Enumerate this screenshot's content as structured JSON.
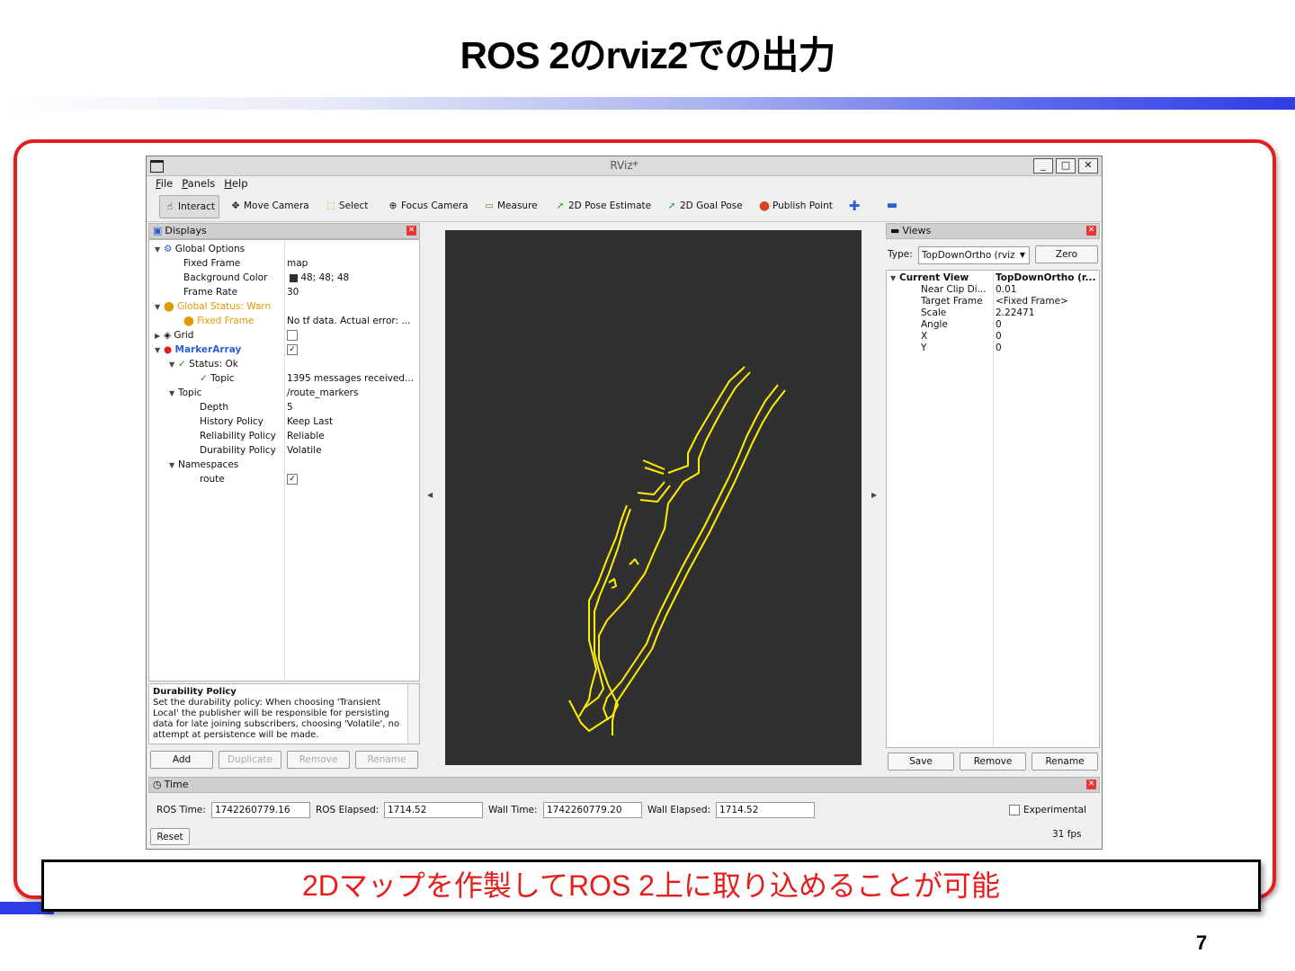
{
  "slide": {
    "title": "ROS 2のrviz2での出力",
    "caption": "2Dマップを作製してROS 2上に取り込めることが可能",
    "page_number": "7"
  },
  "window": {
    "title": "RViz*",
    "controls": {
      "minimize": "_",
      "maximize": "□",
      "close": "✕"
    }
  },
  "menu": [
    "File",
    "Panels",
    "Help"
  ],
  "toolbar": [
    {
      "label": "Interact",
      "icon": "hand-icon",
      "active": true
    },
    {
      "label": "Move Camera",
      "icon": "move-camera-icon"
    },
    {
      "label": "Select",
      "icon": "select-icon"
    },
    {
      "label": "Focus Camera",
      "icon": "focus-camera-icon"
    },
    {
      "label": "Measure",
      "icon": "ruler-icon"
    },
    {
      "label": "2D Pose Estimate",
      "icon": "green-arrow-icon"
    },
    {
      "label": "2D Goal Pose",
      "icon": "green-arrow-icon"
    },
    {
      "label": "Publish Point",
      "icon": "map-pin-icon"
    },
    {
      "label": "",
      "icon": "plus-icon"
    },
    {
      "label": "",
      "icon": "minus-dropdown-icon"
    }
  ],
  "displays": {
    "header": "Displays",
    "rows": [
      {
        "name": "Global Options",
        "value": ""
      },
      {
        "name": "Fixed Frame",
        "value": "map"
      },
      {
        "name": "Background Color",
        "value": "48; 48; 48"
      },
      {
        "name": "Frame Rate",
        "value": "30"
      },
      {
        "name": "Global Status: Warn",
        "value": ""
      },
      {
        "name": "Fixed Frame",
        "value": "No tf data.  Actual error: ..."
      },
      {
        "name": "Grid",
        "value": ""
      },
      {
        "name": "MarkerArray",
        "value": ""
      },
      {
        "name": "Status: Ok",
        "value": ""
      },
      {
        "name": "Topic",
        "value": "1395 messages received..."
      },
      {
        "name": "Topic",
        "value": "/route_markers"
      },
      {
        "name": "Depth",
        "value": "5"
      },
      {
        "name": "History Policy",
        "value": "Keep Last"
      },
      {
        "name": "Reliability Policy",
        "value": "Reliable"
      },
      {
        "name": "Durability Policy",
        "value": "Volatile"
      },
      {
        "name": "Namespaces",
        "value": ""
      },
      {
        "name": "route",
        "value": ""
      }
    ],
    "description_title": "Durability Policy",
    "description_text": "Set the durability policy: When choosing 'Transient Local' the publisher will be responsible for persisting data for late joining subscribers, choosing 'Volatile', no attempt at persistence will be made.",
    "buttons": {
      "add": "Add",
      "duplicate": "Duplicate",
      "remove": "Remove",
      "rename": "Rename"
    }
  },
  "views": {
    "header": "Views",
    "type_label": "Type:",
    "type_value": "TopDownOrtho (rviz",
    "zero_button": "Zero",
    "rows": [
      {
        "name": "Current View",
        "value": "TopDownOrtho (r..."
      },
      {
        "name": "Near Clip Di...",
        "value": "0.01"
      },
      {
        "name": "Target Frame",
        "value": "<Fixed Frame>"
      },
      {
        "name": "Scale",
        "value": "2.22471"
      },
      {
        "name": "Angle",
        "value": "0"
      },
      {
        "name": "X",
        "value": "0"
      },
      {
        "name": "Y",
        "value": "0"
      }
    ],
    "buttons": {
      "save": "Save",
      "remove": "Remove",
      "rename": "Rename"
    }
  },
  "time": {
    "header": "Time",
    "ros_time_label": "ROS Time:",
    "ros_time": "1742260779.16",
    "ros_elapsed_label": "ROS Elapsed:",
    "ros_elapsed": "1714.52",
    "wall_time_label": "Wall Time:",
    "wall_time": "1742260779.20",
    "wall_elapsed_label": "Wall Elapsed:",
    "wall_elapsed": "1714.52",
    "experimental_label": "Experimental",
    "reset_button": "Reset",
    "fps": "31 fps"
  },
  "colors": {
    "accent_red": "#e41d1d",
    "viewport_bg": "#303030",
    "marker_yellow": "#ffee00",
    "title_gradient_end": "#2f3de6"
  }
}
